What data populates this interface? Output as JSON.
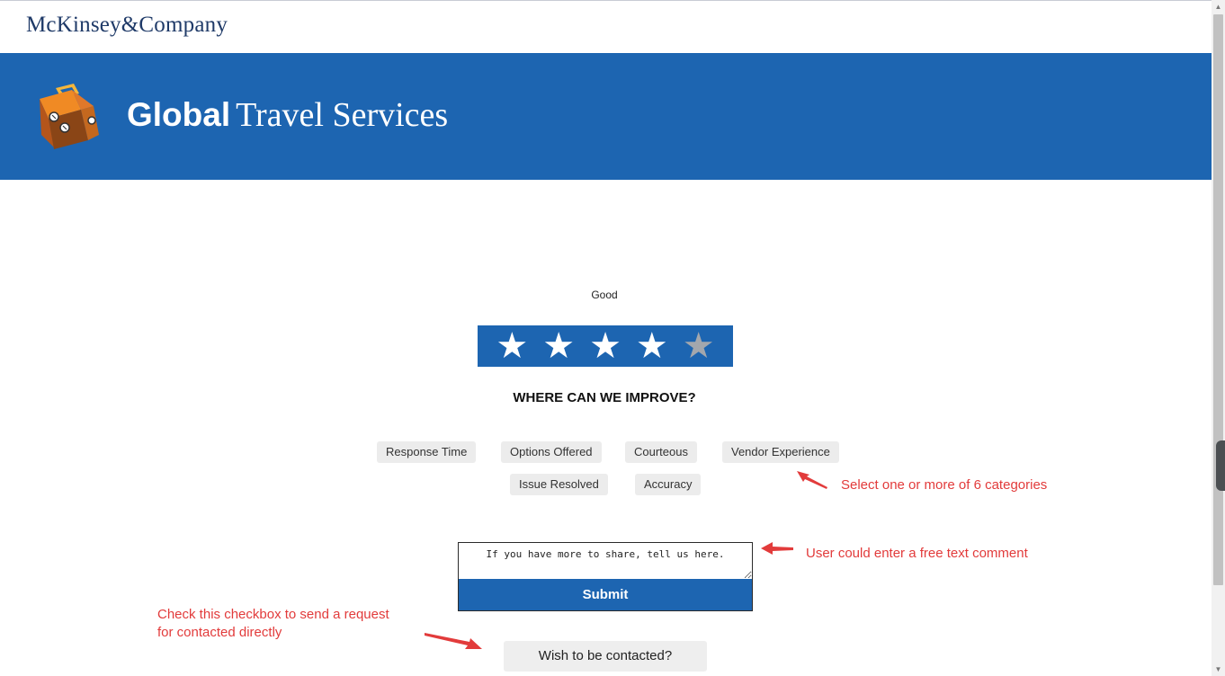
{
  "header": {
    "brand": "McKinsey&Company",
    "banner_title_bold": "Global",
    "banner_title_rest": "Travel Services",
    "logo_icon": "suitcase-icon"
  },
  "rating": {
    "label": "Good",
    "stars_filled": 4,
    "stars_total": 5,
    "star_glyph": "★"
  },
  "improve": {
    "heading": "WHERE CAN WE IMPROVE?",
    "categories": [
      "Response Time",
      "Options Offered",
      "Courteous",
      "Vendor Experience",
      "Issue Resolved",
      "Accuracy"
    ]
  },
  "comment": {
    "placeholder": "If you have more to share, tell us here."
  },
  "submit_label": "Submit",
  "contact_label": "Wish to be contacted?",
  "annotations": {
    "categories_note": "Select one or more of 6 categories",
    "comment_note": "User could enter a free text comment",
    "checkbox_note_line1": "Check this checkbox to send a request",
    "checkbox_note_line2": "for contacted directly"
  },
  "colors": {
    "brand_blue": "#1d65b1",
    "annotation_red": "#e23b3b",
    "star_off": "#a3a7ad"
  }
}
